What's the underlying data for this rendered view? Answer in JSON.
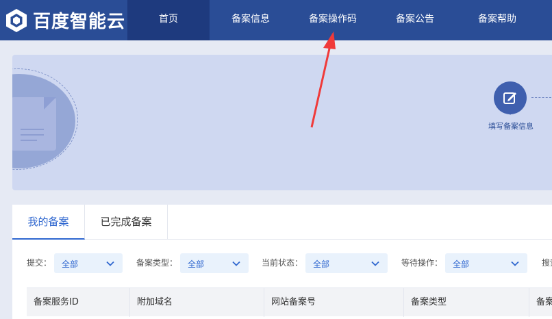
{
  "brand": {
    "name": "百度智能云"
  },
  "nav": {
    "items": [
      {
        "label": "首页",
        "active": true
      },
      {
        "label": "备案信息",
        "active": false
      },
      {
        "label": "备案操作码",
        "active": false
      },
      {
        "label": "备案公告",
        "active": false
      },
      {
        "label": "备案帮助",
        "active": false
      }
    ]
  },
  "banner": {
    "step_label": "填写备案信息",
    "icons": [
      "document-icon",
      "edit-icon"
    ]
  },
  "tabs": [
    {
      "label": "我的备案",
      "active": true
    },
    {
      "label": "已完成备案",
      "active": false
    }
  ],
  "filters": [
    {
      "label": "提交：",
      "value": "全部"
    },
    {
      "label": "备案类型：",
      "value": "全部"
    },
    {
      "label": "当前状态：",
      "value": "全部"
    },
    {
      "label": "等待操作：",
      "value": "全部"
    },
    {
      "label": "搜索",
      "value": ""
    }
  ],
  "table": {
    "columns": [
      "备案服务ID",
      "附加域名",
      "网站备案号",
      "备案类型",
      "备案"
    ]
  },
  "colors": {
    "nav_bg": "#2a4d96",
    "nav_active": "#1e3a7e",
    "accent": "#2e66cf",
    "banner_bg": "#cfd8f1",
    "annotation": "#f03a3a"
  }
}
